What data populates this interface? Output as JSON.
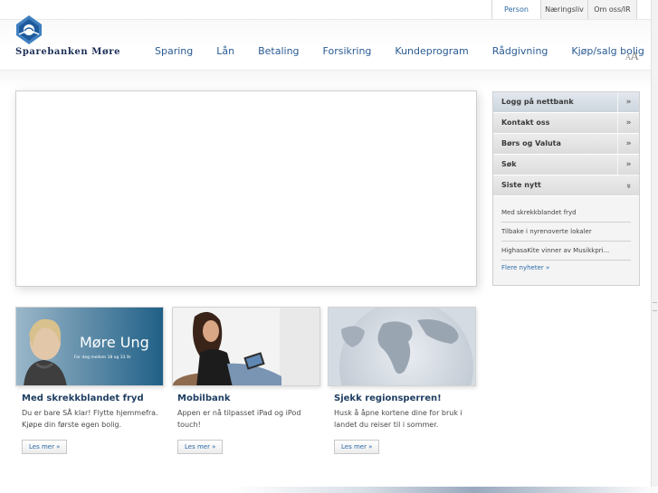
{
  "top_tabs": [
    {
      "label": "Person",
      "active": true
    },
    {
      "label": "Næringsliv",
      "active": false
    },
    {
      "label": "Om oss/IR",
      "active": false
    }
  ],
  "brand": {
    "name": "Sparebanken Møre",
    "color": "#1c2f57"
  },
  "main_nav": [
    "Sparing",
    "Lån",
    "Betaling",
    "Forsikring",
    "Kundeprogram",
    "Rådgivning",
    "Kjøp/salg bolig"
  ],
  "font_size_toggle": {
    "small": "A",
    "large": "A"
  },
  "side_panel": {
    "items": [
      {
        "label": "Logg på nettbank",
        "arrow": "»"
      },
      {
        "label": "Kontakt oss",
        "arrow": "»"
      },
      {
        "label": "Børs og Valuta",
        "arrow": "»"
      },
      {
        "label": "Søk",
        "arrow": "»"
      },
      {
        "label": "Siste nytt",
        "arrow": "»"
      }
    ],
    "news": [
      "Med skrekkblandet fryd",
      "Tilbake i nyrenoverte lokaler",
      "HighasaKite vinner av Musikkpri..."
    ],
    "more_news": "Flere nyheter »"
  },
  "cards": [
    {
      "image_title": "Møre Ung",
      "image_subtitle": "For deg mellom 18 og 33 år",
      "title": "Med skrekkblandet fryd",
      "desc": "Du er bare SÅ klar! Flytte hjemmefra. Kjøpe din første egen bolig.",
      "button": "Les mer »"
    },
    {
      "title": "Mobilbank",
      "desc": "Appen er nå tilpasset iPad og iPod touch!",
      "button": "Les mer »"
    },
    {
      "title": "Sjekk regionsperren!",
      "desc": "Husk å åpne kortene dine for bruk i landet du reiser til i sommer.",
      "button": "Les mer »"
    }
  ],
  "colors": {
    "link": "#2a6aa8",
    "nav": "#2a5b93",
    "heading": "#1f3e62"
  }
}
